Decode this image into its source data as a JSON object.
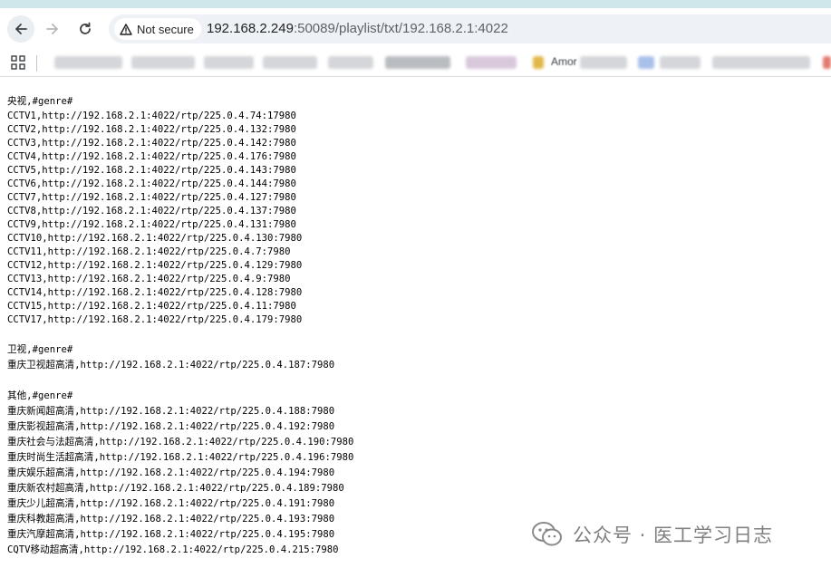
{
  "browser": {
    "security_label": "Not secure",
    "url_host": "192.168.2.249",
    "url_path": ":50089/playlist/txt/192.168.2.1:4022",
    "bookmarks_partial_text": "Amor"
  },
  "sections": [
    {
      "header": "央视,#genre#",
      "lines": [
        "CCTV1,http://192.168.2.1:4022/rtp/225.0.4.74:17980",
        "CCTV2,http://192.168.2.1:4022/rtp/225.0.4.132:7980",
        "CCTV3,http://192.168.2.1:4022/rtp/225.0.4.142:7980",
        "CCTV4,http://192.168.2.1:4022/rtp/225.0.4.176:7980",
        "CCTV5,http://192.168.2.1:4022/rtp/225.0.4.143:7980",
        "CCTV6,http://192.168.2.1:4022/rtp/225.0.4.144:7980",
        "CCTV7,http://192.168.2.1:4022/rtp/225.0.4.127:7980",
        "CCTV8,http://192.168.2.1:4022/rtp/225.0.4.137:7980",
        "CCTV9,http://192.168.2.1:4022/rtp/225.0.4.131:7980",
        "CCTV10,http://192.168.2.1:4022/rtp/225.0.4.130:7980",
        "CCTV11,http://192.168.2.1:4022/rtp/225.0.4.7:7980",
        "CCTV12,http://192.168.2.1:4022/rtp/225.0.4.129:7980",
        "CCTV13,http://192.168.2.1:4022/rtp/225.0.4.9:7980",
        "CCTV14,http://192.168.2.1:4022/rtp/225.0.4.128:7980",
        "CCTV15,http://192.168.2.1:4022/rtp/225.0.4.11:7980",
        "CCTV17,http://192.168.2.1:4022/rtp/225.0.4.179:7980"
      ]
    },
    {
      "header": "卫视,#genre#",
      "lines": [
        "重庆卫视超高清,http://192.168.2.1:4022/rtp/225.0.4.187:7980"
      ]
    },
    {
      "header": "其他,#genre#",
      "lines": [
        "重庆新闻超高清,http://192.168.2.1:4022/rtp/225.0.4.188:7980",
        "重庆影视超高清,http://192.168.2.1:4022/rtp/225.0.4.192:7980",
        "重庆社会与法超高清,http://192.168.2.1:4022/rtp/225.0.4.190:7980",
        "重庆时尚生活超高清,http://192.168.2.1:4022/rtp/225.0.4.196:7980",
        "重庆娱乐超高清,http://192.168.2.1:4022/rtp/225.0.4.194:7980",
        "重庆新农村超高清,http://192.168.2.1:4022/rtp/225.0.4.189:7980",
        "重庆少儿超高清,http://192.168.2.1:4022/rtp/225.0.4.191:7980",
        "重庆科教超高清,http://192.168.2.1:4022/rtp/225.0.4.193:7980",
        "重庆汽摩超高清,http://192.168.2.1:4022/rtp/225.0.4.195:7980",
        "CQTV移动超高清,http://192.168.2.1:4022/rtp/225.0.4.215:7980"
      ]
    }
  ],
  "watermark": {
    "text": "公众号 · 医工学习日志"
  }
}
